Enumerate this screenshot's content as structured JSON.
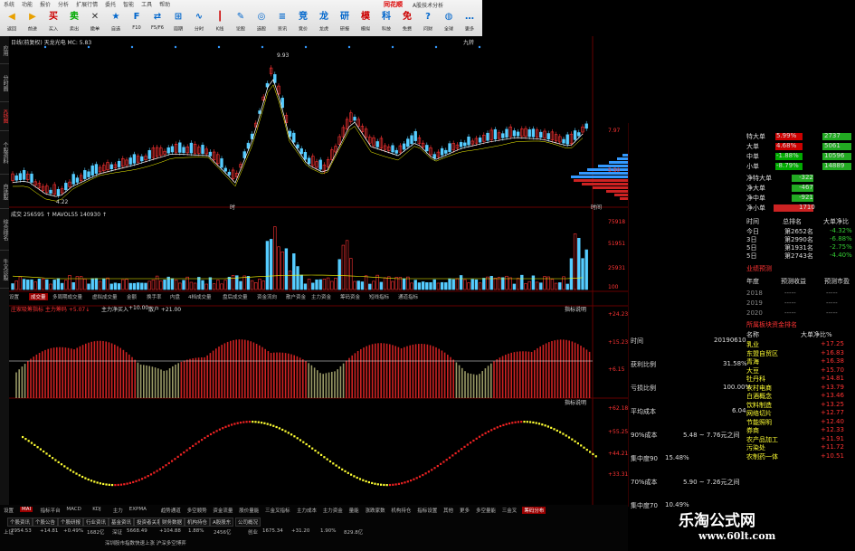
{
  "toolbar": {
    "menu": [
      "系统",
      "功能",
      "报价",
      "分析",
      "扩展行情",
      "委托",
      "智能",
      "工具",
      "帮助"
    ],
    "brand": "同花顺",
    "brand2": "A股技术分析",
    "buttons": [
      {
        "label": "返回",
        "icon": "back-icon",
        "color": "#e8a000"
      },
      {
        "label": "前进",
        "icon": "forward-icon",
        "color": "#e8a000"
      },
      {
        "label": "买入",
        "icon": "buy-icon",
        "color": "#c00"
      },
      {
        "label": "卖出",
        "icon": "sell-icon",
        "color": "#0a0"
      },
      {
        "label": "撤单",
        "icon": "cancel-order-icon",
        "color": "#333"
      },
      {
        "label": "自选",
        "icon": "favorite-icon",
        "color": "#06c"
      },
      {
        "label": "F10",
        "icon": "f10-icon",
        "color": "#06c"
      },
      {
        "label": "F5/F6",
        "icon": "switch-icon",
        "color": "#06c"
      },
      {
        "label": "周期",
        "icon": "period-icon",
        "color": "#06c"
      },
      {
        "label": "分时",
        "icon": "timeshare-icon",
        "color": "#06c"
      },
      {
        "label": "K线",
        "icon": "kline-icon",
        "color": "#c00"
      },
      {
        "label": "论股",
        "icon": "discuss-icon",
        "color": "#06c"
      },
      {
        "label": "选股",
        "icon": "stock-pick-icon",
        "color": "#06c"
      },
      {
        "label": "资讯",
        "icon": "news-icon",
        "color": "#06c"
      },
      {
        "label": "竞价",
        "icon": "auction-icon",
        "color": "#06c"
      },
      {
        "label": "龙虎",
        "icon": "dragon-tiger-icon",
        "color": "#06c"
      },
      {
        "label": "研报",
        "icon": "report-icon",
        "color": "#06c"
      },
      {
        "label": "模拟",
        "icon": "simulate-icon",
        "color": "#c00"
      },
      {
        "label": "科技",
        "icon": "tech-icon",
        "color": "#06c"
      },
      {
        "label": "免费",
        "icon": "free-icon",
        "color": "#c00"
      },
      {
        "label": "问财",
        "icon": "ask-icon",
        "color": "#06c"
      },
      {
        "label": "全球",
        "icon": "globe-icon",
        "color": "#06c"
      },
      {
        "label": "更多",
        "icon": "more-icon",
        "color": "#06c"
      }
    ]
  },
  "sidetabs": [
    "应用",
    "分时图",
    "K线图",
    "个股资料",
    "自选股",
    "综合排名",
    "牛叉诊股"
  ],
  "kline_panel": {
    "header": "日线(前复权)  天龙光电  MC: 5.83",
    "period_label": "九转",
    "high_label": "9.93",
    "low_label": "4.22",
    "right_top_price": "7.97",
    "right_mid_price": "5.50",
    "time_label": "时",
    "time_label2": "时间"
  },
  "volume_panel": {
    "header": "成交  256595 ↑  MAVOL55  140930 ↑",
    "ticks": [
      "75918",
      "51951",
      "25931",
      "100"
    ]
  },
  "indicator_tabs": [
    "设置",
    "成交量",
    "多周期成交量",
    "虚拟成交量",
    "金额",
    "换手率",
    "内盘",
    "4档成交量",
    "盘后成交量",
    "资金流向",
    "散户资金",
    "主力资金",
    "筹码资金",
    "短线指标",
    "通道指标"
  ],
  "macd_panel": {
    "header": "庄家吸筹指标 主力筹码 +5.07↓",
    "sub1": "主力净买入",
    "sub2": "+10.00",
    "sub3": "散户 +21.00",
    "right_label": "指标说明",
    "ticks": [
      "+24.23",
      "+15.23",
      "+6.15"
    ]
  },
  "kdj_panel": {
    "right_label": "指标说明",
    "ticks": [
      "+62.18",
      "+55.25",
      "+44.21",
      "+33.31"
    ]
  },
  "bottom_tabs": [
    "设置",
    "MAI",
    "指标平台",
    "MACD",
    "KDJ",
    "主力",
    "EXPMA",
    "趋势通道",
    "多空顺势",
    "资金流量",
    "股价量能",
    "三金叉指标",
    "主力成本",
    "主力资金",
    "量能",
    "涨跌家数",
    "机构持仓",
    "指标设置",
    "其他",
    "更多",
    "多空量能",
    "三金叉",
    "筹码分布"
  ],
  "bottom_subtabs": [
    "个股资讯",
    "个股公告",
    "个股研报",
    "行业资讯",
    "基金资讯",
    "投资者关系",
    "财务数据",
    "机构持仓",
    "A股股东",
    "公司概况"
  ],
  "status_bar": {
    "items": [
      "上证",
      "2954.53",
      "+14.81",
      "+0.49%",
      "1682亿",
      "深证",
      "5668.49",
      "+104.88",
      "1.88%",
      "2456亿",
      "创业",
      "1675.34",
      "+31.20",
      "1.90%",
      "829.8亿"
    ],
    "marquee": "深圳股市指数快速上涨 沪深多空博弈"
  },
  "right_panel": {
    "fund_flow": [
      {
        "label": "特大单",
        "value": "5.99%",
        "bar_color": "#c00",
        "value2": "2737"
      },
      {
        "label": "大单",
        "value": "4.68%",
        "bar_color": "#c00",
        "value2": "5061"
      },
      {
        "label": "中单",
        "value": "-1.88%",
        "bar_color": "#0a0",
        "value2": "10596"
      },
      {
        "label": "小单",
        "value": "-8.79%",
        "bar_color": "#0a0",
        "value2": "14889"
      }
    ],
    "net_flow": [
      {
        "label": "净特大单",
        "value": "-322"
      },
      {
        "label": "净大单",
        "value": "-467"
      },
      {
        "label": "净中单",
        "value": "-921"
      },
      {
        "label": "净小单",
        "value": "1710"
      }
    ],
    "rank_header": [
      "时间",
      "总排名",
      "大单净比"
    ],
    "rank_rows": [
      {
        "t": "今日",
        "rank": "第2652名",
        "pct": "-4.32%"
      },
      {
        "t": "3日",
        "rank": "第2990名",
        "pct": "-6.88%"
      },
      {
        "t": "5日",
        "rank": "第1931名",
        "pct": "-2.75%"
      },
      {
        "t": "5日",
        "rank": "第2743名",
        "pct": "-4.40%"
      }
    ],
    "forecast_title": "业绩预测",
    "forecast_header": [
      "年度",
      "预测收益",
      "预测市盈"
    ],
    "forecast_rows": [
      [
        "2018",
        "-----",
        "-----"
      ],
      [
        "2019",
        "-----",
        "-----"
      ],
      [
        "2020",
        "-----",
        "-----"
      ]
    ],
    "chip_title": "所属板块资金排名",
    "chip_info": [
      {
        "label": "时间",
        "value": "20190610"
      },
      {
        "label": "获利比例",
        "value": "31.58%"
      },
      {
        "label": "亏损比例",
        "value": "100.00%"
      },
      {
        "label": "平均成本",
        "value": "6.04"
      },
      {
        "label": "90%成本",
        "value": "5.48 ~ 7.76元之间"
      },
      {
        "label": "集中度90",
        "value": "15.48%"
      },
      {
        "label": "70%成本",
        "value": "5.90 ~ 7.26元之间"
      },
      {
        "label": "集中度70",
        "value": "10.49%"
      }
    ],
    "sector_header": [
      "名称",
      "大单净比%"
    ],
    "sectors": [
      {
        "name": "乳业",
        "pct": "+17.25"
      },
      {
        "name": "东盟自贸区",
        "pct": "+16.83"
      },
      {
        "name": "青海",
        "pct": "+16.38"
      },
      {
        "name": "大豆",
        "pct": "+15.70"
      },
      {
        "name": "牡丹科",
        "pct": "+14.81"
      },
      {
        "name": "农村电商",
        "pct": "+13.79"
      },
      {
        "name": "白酒概念",
        "pct": "+13.46"
      },
      {
        "name": "饮料制造",
        "pct": "+13.25"
      },
      {
        "name": "网络切片",
        "pct": "+12.77"
      },
      {
        "name": "节能照明",
        "pct": "+12.40"
      },
      {
        "name": "券商",
        "pct": "+12.33"
      },
      {
        "name": "农产品加工",
        "pct": "+11.91"
      },
      {
        "name": "污染处",
        "pct": "+11.72"
      },
      {
        "name": "农制药一体",
        "pct": "+10.51"
      }
    ]
  },
  "watermark": {
    "title": "乐淘公式网",
    "url": "www.60lt.com"
  }
}
